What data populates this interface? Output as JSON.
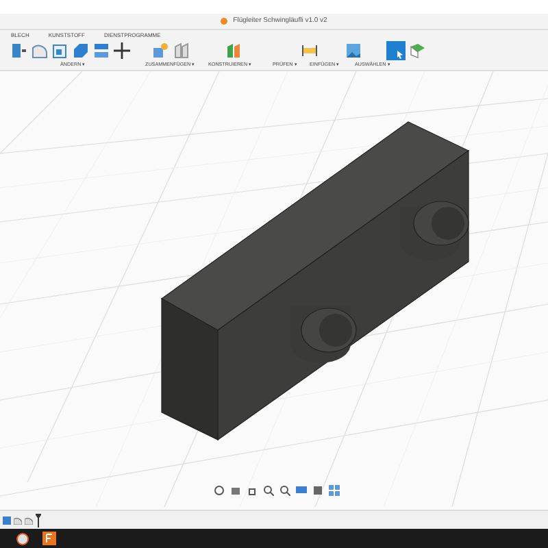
{
  "window": {
    "title": "Flügleiter Schwingläufli v1.0 v2"
  },
  "tabs": [
    {
      "label": "BLECH",
      "selected": false
    },
    {
      "label": "KUNSTSTOFF",
      "selected": false
    },
    {
      "label": "DIENSTPROGRAMME",
      "selected": false
    }
  ],
  "toolbar_groups": [
    {
      "label": "ÄNDERN ▾"
    },
    {
      "label": "ZUSAMMENFÜGEN ▾"
    },
    {
      "label": "KONSTRUIEREN ▾"
    },
    {
      "label": "PRÜFEN ▾"
    },
    {
      "label": "EINFÜGEN ▾"
    },
    {
      "label": "AUSWÄHLEN ▾"
    }
  ]
}
